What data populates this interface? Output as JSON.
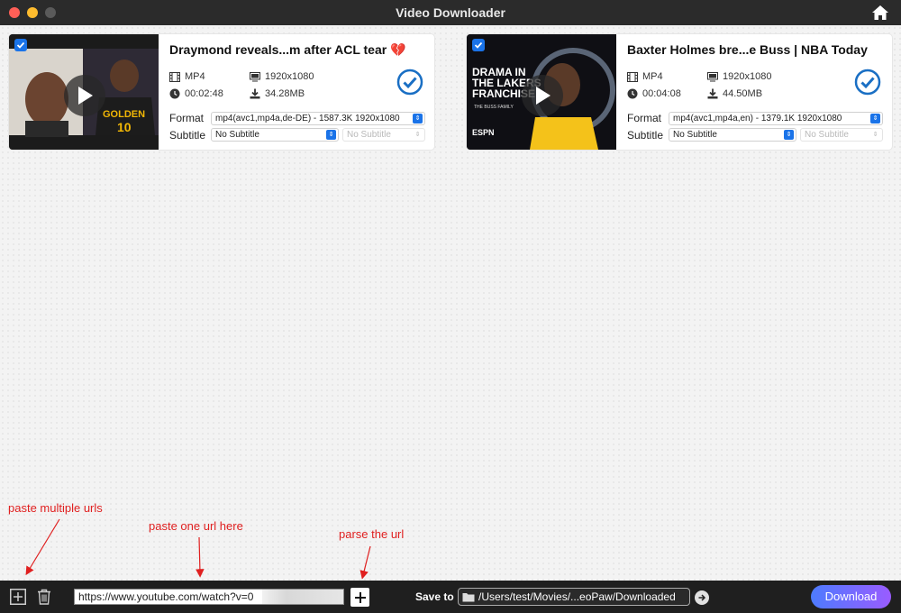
{
  "window": {
    "title": "Video Downloader"
  },
  "videos": [
    {
      "title": "Draymond reveals...m after ACL tear 💔",
      "format_type": "MP4",
      "resolution": "1920x1080",
      "duration": "00:02:48",
      "size": "34.28MB",
      "format_label": "Format",
      "format_value": "mp4(avc1,mp4a,de-DE) - 1587.3K 1920x1080",
      "subtitle_label": "Subtitle",
      "subtitle_value": "No Subtitle",
      "subtitle_secondary": "No Subtitle",
      "thumb_text": "GOLDEN",
      "thumb_number": "10"
    },
    {
      "title": "Baxter Holmes bre...e Buss | NBA Today",
      "format_type": "MP4",
      "resolution": "1920x1080",
      "duration": "00:04:08",
      "size": "44.50MB",
      "format_label": "Format",
      "format_value": "mp4(avc1,mp4a,en) - 1379.1K 1920x1080",
      "subtitle_label": "Subtitle",
      "subtitle_value": "No Subtitle",
      "subtitle_secondary": "No Subtitle",
      "thumb_text": "DRAMA IN THE LAKERS FRANCHISE",
      "thumb_sub": "THE BUSS FAMILY",
      "thumb_brand": "ESPN"
    }
  ],
  "annotations": {
    "multi": "paste multiple urls",
    "one": "paste one url here",
    "parse": "parse the url"
  },
  "bottom": {
    "url_value": "https://www.youtube.com/watch?v=0",
    "save_label": "Save to",
    "save_path": "/Users/test/Movies/...eoPaw/Downloaded",
    "download_label": "Download"
  },
  "colors": {
    "accent": "#1a73e8",
    "annotation": "#e02020",
    "download_gradient_start": "#4d7bff",
    "download_gradient_end": "#9a5cff"
  }
}
